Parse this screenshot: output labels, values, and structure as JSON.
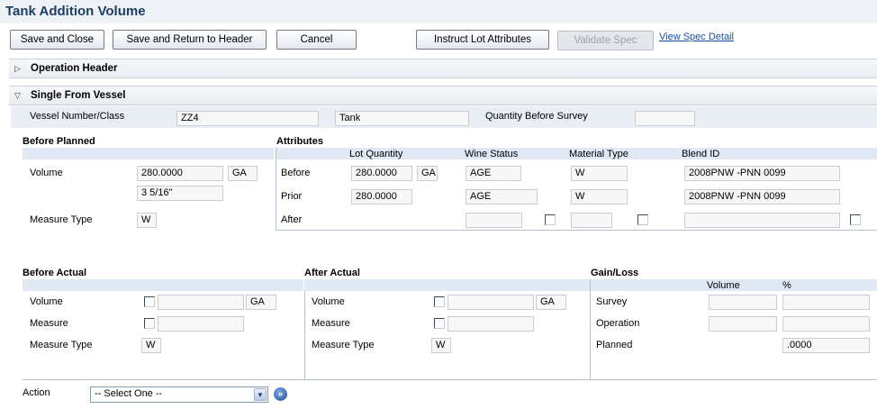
{
  "title": "Tank Addition Volume",
  "toolbar": {
    "save_close": "Save and Close",
    "save_return": "Save and Return to Header",
    "cancel": "Cancel",
    "instruct_lot": "Instruct Lot Attributes",
    "validate_spec": "Validate Spec",
    "view_spec_detail": "View Spec Detail"
  },
  "sections": {
    "operation_header": "Operation Header",
    "single_from_vessel": "Single From Vessel"
  },
  "vessel": {
    "vessel_label": "Vessel Number/Class",
    "vessel_number": "ZZ4",
    "vessel_class": "Tank",
    "qty_before_label": "Quantity Before Survey",
    "qty_before_value": ""
  },
  "before_planned": {
    "heading": "Before Planned",
    "volume_label": "Volume",
    "volume_value": "280.0000",
    "volume_uom": "GA",
    "measure_value": "3 5/16\"",
    "measure_type_label": "Measure Type",
    "measure_type_value": "W"
  },
  "attributes": {
    "heading": "Attributes",
    "columns": [
      "Lot Quantity",
      "Wine Status",
      "Material Type",
      "Blend ID"
    ],
    "rows": [
      {
        "label": "Before",
        "lot_qty": "280.0000",
        "uom": "GA",
        "wine_status": "AGE",
        "material": "W",
        "blend": "2008PNW   -PNN   0099"
      },
      {
        "label": "Prior",
        "lot_qty": "280.0000",
        "uom": "",
        "wine_status": "AGE",
        "material": "W",
        "blend": "2008PNW   -PNN   0099"
      },
      {
        "label": "After",
        "lot_qty": "",
        "uom": "",
        "wine_status": "",
        "material": "",
        "blend": ""
      }
    ]
  },
  "before_actual": {
    "heading": "Before Actual",
    "volume_label": "Volume",
    "volume_uom": "GA",
    "measure_label": "Measure",
    "measure_type_label": "Measure Type",
    "measure_type_value": "W"
  },
  "after_actual": {
    "heading": "After Actual",
    "volume_label": "Volume",
    "volume_uom": "GA",
    "measure_label": "Measure",
    "measure_type_label": "Measure Type",
    "measure_type_value": "W"
  },
  "gain_loss": {
    "heading": "Gain/Loss",
    "col_volume": "Volume",
    "col_pct": "%",
    "survey_label": "Survey",
    "operation_label": "Operation",
    "planned_label": "Planned",
    "planned_pct": ".0000"
  },
  "action": {
    "label": "Action",
    "selected": "-- Select One --"
  },
  "icons": {
    "expand": "triangle-right",
    "collapse": "triangle-down",
    "go": "double-chevron-right"
  }
}
